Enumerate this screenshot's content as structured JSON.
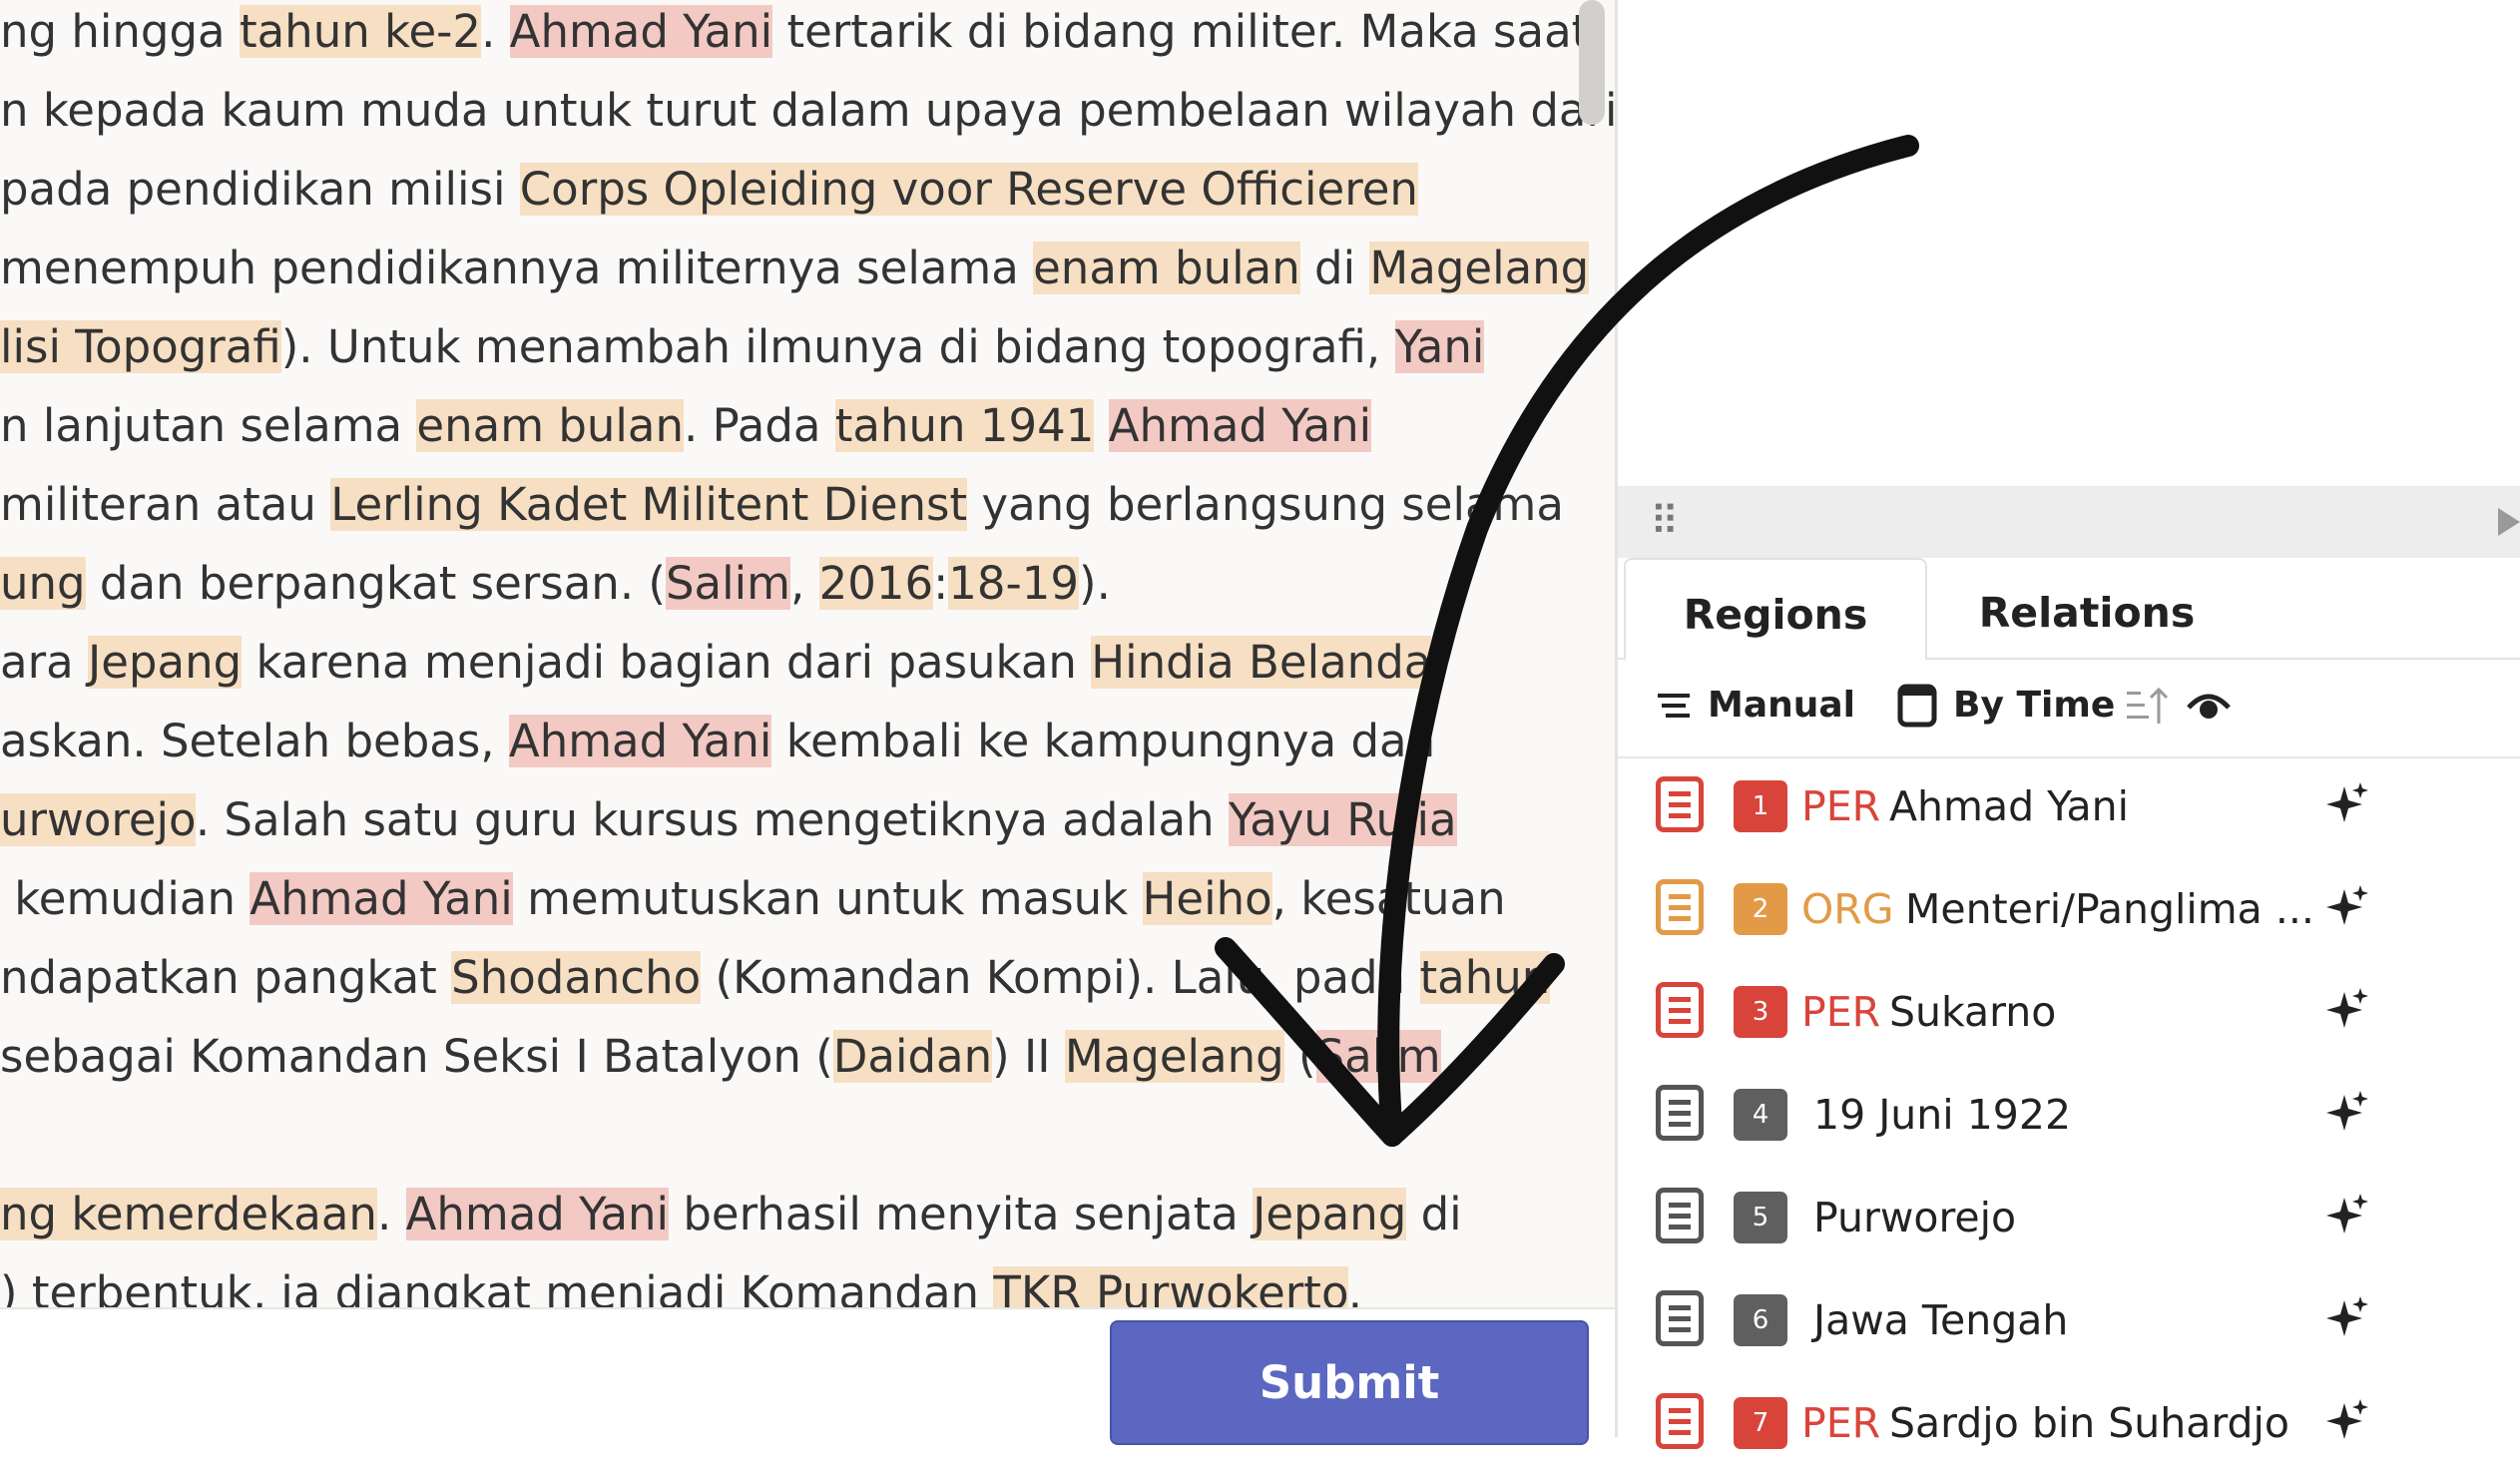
{
  "editor": {
    "lines": [
      [
        [
          "ng hingga ",
          ""
        ],
        [
          "tahun ke-2",
          "oth"
        ],
        [
          ". ",
          ""
        ],
        [
          "Ahmad Yani",
          "per"
        ],
        [
          " tertarik di bidang militer. Maka saat",
          ""
        ]
      ],
      [
        [
          "n kepada kaum muda untuk turut dalam upaya pembelaan wilayah dari",
          ""
        ]
      ],
      [
        [
          "pada pendidikan milisi ",
          ""
        ],
        [
          "Corps Opleiding voor Reserve Officieren",
          "oth"
        ]
      ],
      [
        [
          "menempuh pendidikannya militernya selama ",
          ""
        ],
        [
          "enam bulan",
          "oth"
        ],
        [
          " di ",
          ""
        ],
        [
          "Magelang",
          "oth"
        ]
      ],
      [
        [
          "lisi Topografi",
          "oth"
        ],
        [
          "). Untuk menambah ilmunya di bidang topografi, ",
          ""
        ],
        [
          "Yani",
          "per"
        ]
      ],
      [
        [
          "n lanjutan selama ",
          ""
        ],
        [
          "enam bulan",
          "oth"
        ],
        [
          ". Pada ",
          ""
        ],
        [
          "tahun 1941",
          "oth"
        ],
        [
          " ",
          ""
        ],
        [
          "Ahmad Yani",
          "per"
        ]
      ],
      [
        [
          "militeran atau ",
          ""
        ],
        [
          "Lerling Kadet Militent Dienst",
          "oth"
        ],
        [
          " yang berlangsung selama",
          ""
        ]
      ],
      [
        [
          "ung",
          "oth"
        ],
        [
          " dan berpangkat sersan. (",
          ""
        ],
        [
          "Salim",
          "per"
        ],
        [
          ", ",
          ""
        ],
        [
          "2016",
          "oth"
        ],
        [
          ":",
          ""
        ],
        [
          "18-19",
          "oth"
        ],
        [
          ").",
          ""
        ]
      ],
      [
        [
          "ara ",
          ""
        ],
        [
          "Jepang",
          "oth"
        ],
        [
          " karena menjadi bagian dari pasukan ",
          ""
        ],
        [
          "Hindia Belanda",
          "oth"
        ],
        [
          ".",
          ""
        ]
      ],
      [
        [
          "askan. Setelah bebas, ",
          ""
        ],
        [
          "Ahmad Yani",
          "per"
        ],
        [
          " kembali ke kampungnya dan",
          ""
        ]
      ],
      [
        [
          "urworejo",
          "oth"
        ],
        [
          ". Salah satu guru kursus mengetiknya adalah ",
          ""
        ],
        [
          "Yayu Rulia",
          "per"
        ]
      ],
      [
        [
          " kemudian ",
          ""
        ],
        [
          "Ahmad Yani",
          "per"
        ],
        [
          " memutuskan untuk masuk ",
          ""
        ],
        [
          "Heiho",
          "oth"
        ],
        [
          ", kesatuan",
          ""
        ]
      ],
      [
        [
          "ndapatkan pangkat ",
          ""
        ],
        [
          "Shodancho",
          "oth"
        ],
        [
          " (Komandan Kompi). Lalu, pada ",
          ""
        ],
        [
          "tahun",
          "oth"
        ]
      ],
      [
        [
          "sebagai Komandan Seksi I Batalyon (",
          ""
        ],
        [
          "Daidan",
          "oth"
        ],
        [
          ") II ",
          ""
        ],
        [
          "Magelang",
          "oth"
        ],
        [
          " (",
          ""
        ],
        [
          "Salim",
          "per"
        ]
      ],
      [],
      [
        [
          "ng kemerdekaan",
          "oth"
        ],
        [
          ". ",
          ""
        ],
        [
          "Ahmad Yani",
          "per"
        ],
        [
          " berhasil menyita senjata ",
          ""
        ],
        [
          "Jepang",
          "oth"
        ],
        [
          " di",
          ""
        ]
      ],
      [
        [
          ") terbentuk, ia diangkat menjadi Komandan ",
          ""
        ],
        [
          "TKR Purwokerto",
          "oth"
        ],
        [
          ".",
          ""
        ]
      ]
    ]
  },
  "submit_label": "Submit",
  "tabs": {
    "regions": "Regions",
    "relations": "Relations"
  },
  "toolbar": {
    "manual": "Manual",
    "by_time": "By Time"
  },
  "regions": [
    {
      "num": "1",
      "label": "PER",
      "text": "Ahmad Yani",
      "color": "#d9443a",
      "icon_color": "#d9443a"
    },
    {
      "num": "2",
      "label": "ORG",
      "text": "Menteri/Panglima ...",
      "color": "#e39a46",
      "icon_color": "#e39a46"
    },
    {
      "num": "3",
      "label": "PER",
      "text": "Sukarno",
      "color": "#d9443a",
      "icon_color": "#d9443a"
    },
    {
      "num": "4",
      "label": "",
      "text": "19 Juni 1922",
      "color": "#5f5f5f",
      "icon_color": "#555555"
    },
    {
      "num": "5",
      "label": "",
      "text": "Purworejo",
      "color": "#5f5f5f",
      "icon_color": "#555555"
    },
    {
      "num": "6",
      "label": "",
      "text": "Jawa Tengah",
      "color": "#5f5f5f",
      "icon_color": "#555555"
    },
    {
      "num": "7",
      "label": "PER",
      "text": "Sardjo bin Suhardjo",
      "color": "#d9443a",
      "icon_color": "#d9443a"
    }
  ]
}
